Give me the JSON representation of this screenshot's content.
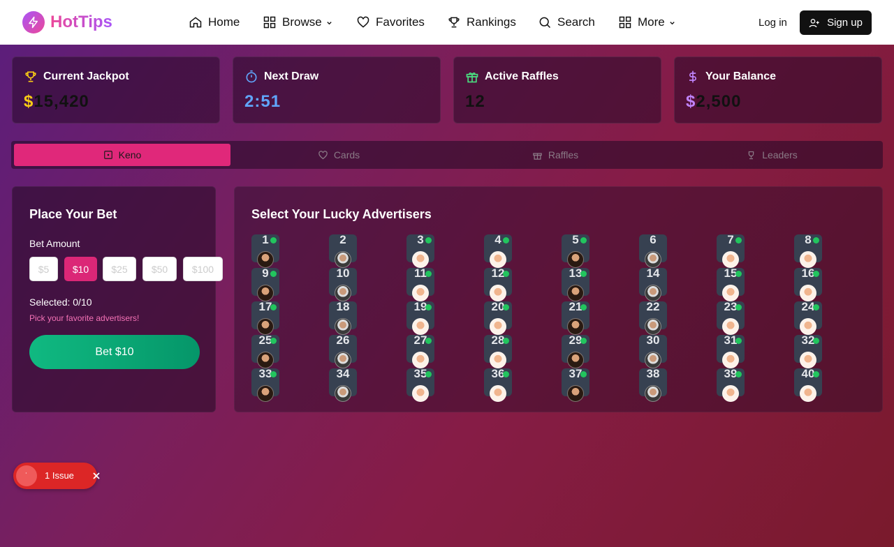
{
  "nav": {
    "brand": "HotTips",
    "items": [
      {
        "label": "Home",
        "icon": "home-icon"
      },
      {
        "label": "Browse",
        "icon": "grid-icon",
        "dropdown": true
      },
      {
        "label": "Favorites",
        "icon": "heart-icon"
      },
      {
        "label": "Rankings",
        "icon": "trophy-icon"
      },
      {
        "label": "Search",
        "icon": "search-icon"
      },
      {
        "label": "More",
        "icon": "grid-icon",
        "dropdown": true
      }
    ],
    "login": "Log in",
    "signup": "Sign up"
  },
  "stats": [
    {
      "label": "Current Jackpot",
      "currency": "$",
      "value": "15,420",
      "icon": "trophy-icon",
      "color": "#facc15"
    },
    {
      "label": "Next Draw",
      "value": "2:51",
      "icon": "timer-icon",
      "color": "#60a5fa"
    },
    {
      "label": "Active Raffles",
      "value": "12",
      "icon": "gift-icon",
      "color": "#4ade80"
    },
    {
      "label": "Your Balance",
      "currency": "$",
      "value": "2,500",
      "icon": "dollar-icon",
      "color": "#c084fc"
    }
  ],
  "tabs": [
    {
      "label": "Keno",
      "icon": "dice-icon",
      "active": true
    },
    {
      "label": "Cards",
      "icon": "heart-icon"
    },
    {
      "label": "Raffles",
      "icon": "gift-icon"
    },
    {
      "label": "Leaders",
      "icon": "trophy-icon"
    }
  ],
  "bet": {
    "title": "Place Your Bet",
    "amount_label": "Bet Amount",
    "amounts": [
      "$5",
      "$10",
      "$25",
      "$50",
      "$100"
    ],
    "selected_amount": "$10",
    "selected_text": "Selected: 0/10",
    "hint": "Pick your favorite advertisers!",
    "button": "Bet $10"
  },
  "grid": {
    "title": "Select Your Lucky Advertisers",
    "tiles": [
      {
        "n": "1",
        "online": true
      },
      {
        "n": "2",
        "online": false
      },
      {
        "n": "3",
        "online": true
      },
      {
        "n": "4",
        "online": true
      },
      {
        "n": "5",
        "online": true
      },
      {
        "n": "6",
        "online": false
      },
      {
        "n": "7",
        "online": true
      },
      {
        "n": "8",
        "online": true
      },
      {
        "n": "9",
        "online": true
      },
      {
        "n": "10",
        "online": false
      },
      {
        "n": "11",
        "online": true
      },
      {
        "n": "12",
        "online": true
      },
      {
        "n": "13",
        "online": true
      },
      {
        "n": "14",
        "online": false
      },
      {
        "n": "15",
        "online": true
      },
      {
        "n": "16",
        "online": true
      },
      {
        "n": "17",
        "online": true
      },
      {
        "n": "18",
        "online": false
      },
      {
        "n": "19",
        "online": true
      },
      {
        "n": "20",
        "online": true
      },
      {
        "n": "21",
        "online": true
      },
      {
        "n": "22",
        "online": false
      },
      {
        "n": "23",
        "online": true
      },
      {
        "n": "24",
        "online": true
      },
      {
        "n": "25",
        "online": true
      },
      {
        "n": "26",
        "online": false
      },
      {
        "n": "27",
        "online": true
      },
      {
        "n": "28",
        "online": true
      },
      {
        "n": "29",
        "online": true
      },
      {
        "n": "30",
        "online": false
      },
      {
        "n": "31",
        "online": true
      },
      {
        "n": "32",
        "online": true
      },
      {
        "n": "33",
        "online": true
      },
      {
        "n": "34",
        "online": false
      },
      {
        "n": "35",
        "online": true
      },
      {
        "n": "36",
        "online": true
      },
      {
        "n": "37",
        "online": true
      },
      {
        "n": "38",
        "online": false
      },
      {
        "n": "39",
        "online": true
      },
      {
        "n": "40",
        "online": true
      }
    ]
  },
  "issue": {
    "label": "1 Issue"
  }
}
